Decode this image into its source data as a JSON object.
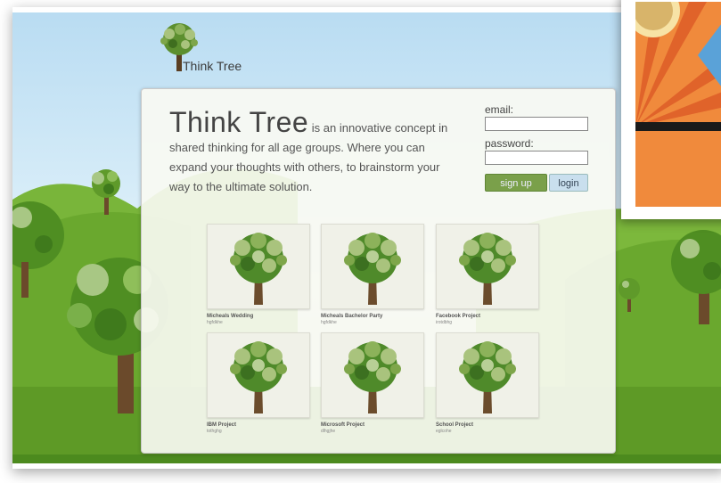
{
  "brand": {
    "logo_text": "Think Tree"
  },
  "intro": {
    "headline": "Think Tree",
    "body": " is an innovative concept in shared thinking for all age groups. Where you can expand your thoughts with others, to brainstorm your way to the ultimate solution."
  },
  "login_form": {
    "email_label": "email:",
    "password_label": "password:",
    "signup_label": "sign up",
    "login_label": "login"
  },
  "projects": [
    {
      "title": "Micheals Wedding",
      "code": "hgfdkhe"
    },
    {
      "title": "Micheals Bachelor Party",
      "code": "hgfdkhe"
    },
    {
      "title": "Facebook Project",
      "code": "irotdbhg"
    },
    {
      "title": "IBM Project",
      "code": "tothghg"
    },
    {
      "title": "Microsoft Project",
      "code": "dlhgjhe"
    },
    {
      "title": "School Project",
      "code": "eglcohe"
    }
  ],
  "colors": {
    "grass_dark": "#4c8a1e",
    "grass_light": "#8cc63f",
    "signup_button": "#7aa04a",
    "login_button": "#c9dfee",
    "panel_bg": "#f8faf2"
  },
  "icons": [
    "tree-logo-icon",
    "tree-thumbnail-icon"
  ]
}
